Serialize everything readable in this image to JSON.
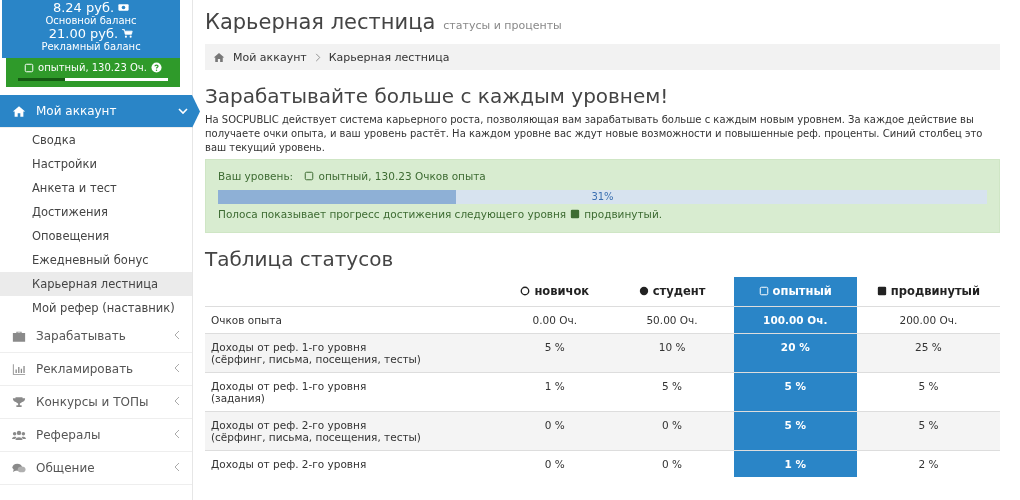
{
  "balance": {
    "main_amount": "8.24 руб.",
    "main_label": "Основной баланс",
    "ad_amount": "21.00 руб.",
    "ad_label": "Рекламный баланс",
    "status": "опытный, 130.23 Оч.",
    "level": 0.31
  },
  "sidebar": {
    "items": [
      {
        "label": "Мой аккаунт",
        "kind": "home",
        "expanded": true,
        "children": [
          {
            "label": "Сводка",
            "selected": false
          },
          {
            "label": "Настройки",
            "selected": false
          },
          {
            "label": "Анкета и тест",
            "selected": false
          },
          {
            "label": "Достижения",
            "selected": false
          },
          {
            "label": "Оповещения",
            "selected": false
          },
          {
            "label": "Ежедневный бонус",
            "selected": false
          },
          {
            "label": "Карьерная лестница",
            "selected": true
          },
          {
            "label": "Мой рефер (наставник)",
            "selected": false
          }
        ]
      },
      {
        "label": "Зарабатывать",
        "kind": "briefcase",
        "expanded": false
      },
      {
        "label": "Рекламировать",
        "kind": "chart",
        "expanded": false
      },
      {
        "label": "Конкурсы и ТОПы",
        "kind": "trophy",
        "expanded": false
      },
      {
        "label": "Рефералы",
        "kind": "users",
        "expanded": false
      },
      {
        "label": "Общение",
        "kind": "chat",
        "expanded": false
      }
    ]
  },
  "page": {
    "title": "Карьерная лестница",
    "subtitle": "статусы и проценты"
  },
  "breadcrumb": [
    "Мой аккаунт",
    "Карьерная лестница"
  ],
  "intro": {
    "heading": "Зарабатывайте больше с каждым уровнем!",
    "text": "На SOCPUBLIC действует система карьерного роста, позволяющая вам зарабатывать больше с каждым новым уровнем. За каждое действие вы получаете очки опыта, и ваш уровень растёт. На каждом уровне вас ждут новые возможности и повышенные реф. проценты. Синий столбец это ваш текущий уровень."
  },
  "progress": {
    "label": "Ваш уровень:",
    "status": {
      "kind": "square-outline",
      "text": "опытный, 130.23 Очков опыта"
    },
    "level": 0.31,
    "reading": "31%",
    "note": "Полоса показывает прогресс достижения следующего уровня",
    "next": {
      "kind": "square",
      "text": "продвинутый."
    }
  },
  "table": {
    "title": "Таблица статусов",
    "columns": [
      {
        "label": "новичок",
        "kind": "circle-outline",
        "current": false
      },
      {
        "label": "студент",
        "kind": "circle",
        "current": false
      },
      {
        "label": "опытный",
        "kind": "square-outline",
        "current": true
      },
      {
        "label": "продвинутый",
        "kind": "square",
        "current": false
      }
    ],
    "rows": [
      {
        "label": [
          "Очков опыта"
        ],
        "cells": [
          "0.00 Оч.",
          "50.00 Оч.",
          "100.00 Оч.",
          "200.00 Оч."
        ]
      },
      {
        "label": [
          "Доходы от реф. 1-го уровня",
          "(сёрфинг, письма, посещения, тесты)"
        ],
        "cells": [
          "5 %",
          "10 %",
          "20 %",
          "25 %"
        ]
      },
      {
        "label": [
          "Доходы от реф. 1-го уровня",
          "(задания)"
        ],
        "cells": [
          "1 %",
          "5 %",
          "5 %",
          "5 %"
        ]
      },
      {
        "label": [
          "Доходы от реф. 2-го уровня",
          "(сёрфинг, письма, посещения, тесты)"
        ],
        "cells": [
          "0 %",
          "0 %",
          "5 %",
          "5 %"
        ]
      },
      {
        "label": [
          "Доходы от реф. 2-го уровня"
        ],
        "cells": [
          "0 %",
          "0 %",
          "1 %",
          "2 %"
        ]
      }
    ]
  }
}
